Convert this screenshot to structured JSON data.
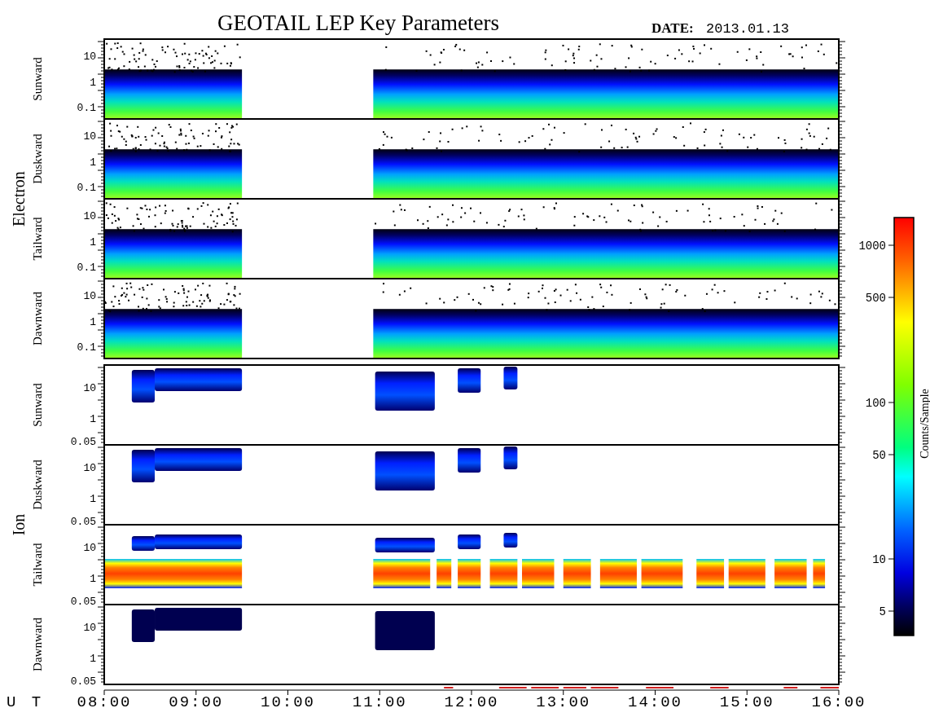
{
  "title": "GEOTAIL LEP Key Parameters",
  "date_label": "DATE:",
  "date": "2013.01.13",
  "groups": [
    {
      "label": "Electron",
      "kind": "electron",
      "panels": [
        {
          "label": "Sunward",
          "yticks": [
            "10",
            "1",
            "0.1"
          ]
        },
        {
          "label": "Duskward",
          "yticks": [
            "10",
            "1",
            "0.1"
          ]
        },
        {
          "label": "Tailward",
          "yticks": [
            "10",
            "1",
            "0.1"
          ]
        },
        {
          "label": "Dawnward",
          "yticks": [
            "10",
            "1",
            "0.1"
          ]
        }
      ]
    },
    {
      "label": "Ion",
      "kind": "ion",
      "panels": [
        {
          "label": "Sunward",
          "yticks": [
            "10",
            "1",
            "0.05"
          ]
        },
        {
          "label": "Duskward",
          "yticks": [
            "10",
            "1",
            "0.05"
          ]
        },
        {
          "label": "Tailward",
          "yticks": [
            "10",
            "1",
            "0.05"
          ]
        },
        {
          "label": "Dawnward",
          "yticks": [
            "10",
            "1",
            "0.05"
          ]
        }
      ]
    }
  ],
  "time_axis": {
    "label": "U T",
    "ticks": [
      "08:00",
      "09:00",
      "10:00",
      "11:00",
      "12:00",
      "13:00",
      "14:00",
      "15:00",
      "16:00"
    ]
  },
  "colorbar": {
    "label": "Counts/Sample",
    "ticks": [
      "1000",
      "500",
      "100",
      "50",
      "10",
      "5"
    ]
  }
}
